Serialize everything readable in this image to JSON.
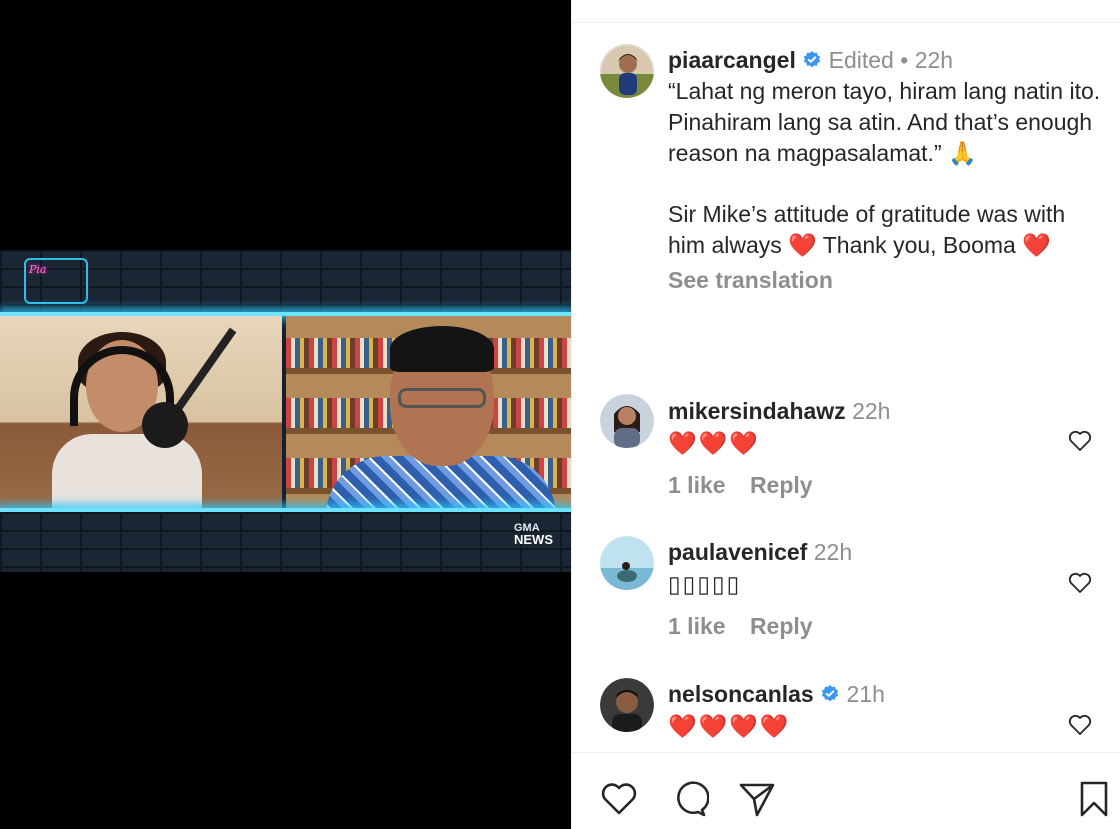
{
  "media": {
    "video_logo": "GMA",
    "video_logo_sub": "NEWS",
    "show_logo_text": "Pia"
  },
  "post": {
    "username": "piaarcangel",
    "edited": "Edited",
    "separator": "•",
    "time": "22h",
    "caption_lines": [
      "“Lahat ng meron tayo, hiram lang natin ito. Pinahiram lang sa atin. And that’s enough reason na magpasalamat.” 🙏",
      "Sir Mike’s attitude of gratitude was with him always ❤️ Thank you, Booma ❤️"
    ],
    "see_translation": "See translation"
  },
  "comments": [
    {
      "username": "mikersindahawz",
      "time": "22h",
      "text": "❤️❤️❤️",
      "likes": "1 like",
      "reply": "Reply",
      "verified": false
    },
    {
      "username": "paulavenicef",
      "time": "22h",
      "text": "▯▯▯▯▯",
      "likes": "1 like",
      "reply": "Reply",
      "verified": false
    },
    {
      "username": "nelsoncanlas",
      "time": "21h",
      "text": "❤️❤️❤️❤️",
      "likes": "",
      "reply": "",
      "verified": true
    }
  ],
  "actions": {
    "like_icon": "heart-outline-icon",
    "comment_icon": "comment-bubble-icon",
    "share_icon": "paper-plane-icon",
    "save_icon": "bookmark-icon"
  },
  "colors": {
    "verified_blue": "#3897f0",
    "text": "#262626",
    "muted": "#8e8e8e",
    "neon": "#27c5ff"
  }
}
